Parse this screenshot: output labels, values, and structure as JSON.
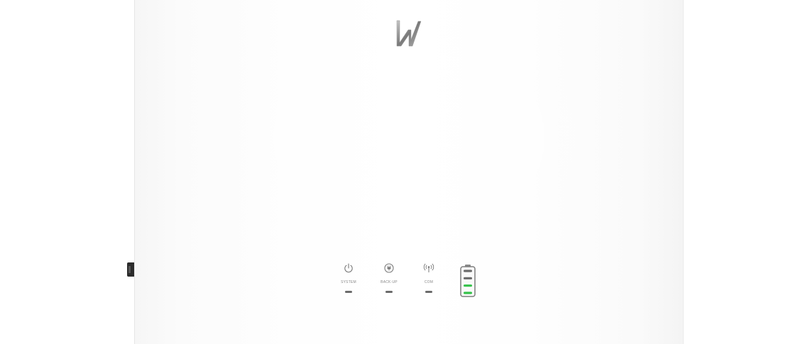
{
  "scene": {
    "description_color_body": "#ffffff",
    "accent_led_color": "#35c24a",
    "off_led_color": "#6b6b6b"
  },
  "logo": {
    "icon": "brand-logo-icon"
  },
  "indicators": [
    {
      "icon": "power-icon",
      "label": "SYSTEM"
    },
    {
      "icon": "plug-icon",
      "label": "BACK-UP"
    },
    {
      "icon": "antenna-icon",
      "label": "COM"
    }
  ],
  "battery": {
    "icon": "battery-level-icon",
    "segments_total": 4,
    "segments_lit": 2,
    "level": 0.5
  }
}
